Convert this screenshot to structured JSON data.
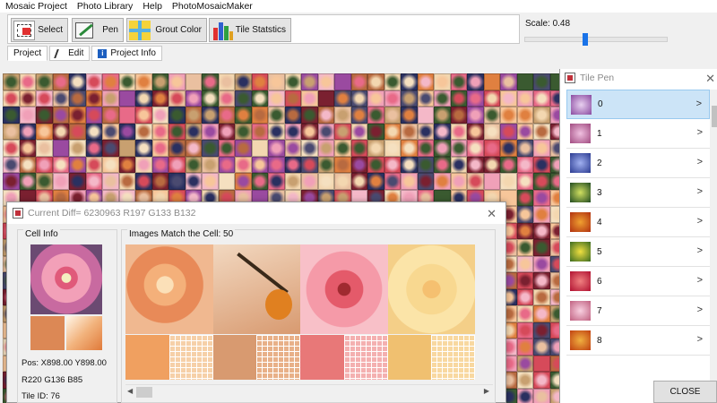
{
  "menu": [
    "Mosaic Project",
    "Photo Library",
    "Help",
    "PhotoMosaicMaker"
  ],
  "toolbar": {
    "select_label": "Select",
    "pen_label": "Pen",
    "grout_label": "Grout Color",
    "stats_label": "Tile Statstics"
  },
  "scale": {
    "label": "Scale: 0.48",
    "value": 0.48
  },
  "tabs": [
    "Project",
    "Edit",
    "Project Info"
  ],
  "diff_dialog": {
    "title": "Current Diff= 6230963 R197 G133 B132",
    "cell_info": {
      "title": "Cell Info",
      "pos": "Pos: X898.00 Y898.00",
      "rgb": "R220 G136 B85",
      "tile_id": "Tile ID: 76"
    },
    "match_title": "Images Match the Cell: 50"
  },
  "tile_pen": {
    "title": "Tile Pen",
    "items": [
      "0",
      "1",
      "2",
      "3",
      "4",
      "5",
      "6",
      "7",
      "8"
    ],
    "selected": "0"
  },
  "close_label": "CLOSE",
  "colors": {
    "accent": "#1a73e8",
    "selection": "#cce4f7",
    "swatch_main": "#dc8855"
  },
  "icons": [
    "select-icon",
    "pen-icon",
    "grout-color-icon",
    "bar-chart-icon",
    "edit-icon",
    "info-icon",
    "app-icon",
    "close-icon",
    "chevron-right-icon"
  ]
}
